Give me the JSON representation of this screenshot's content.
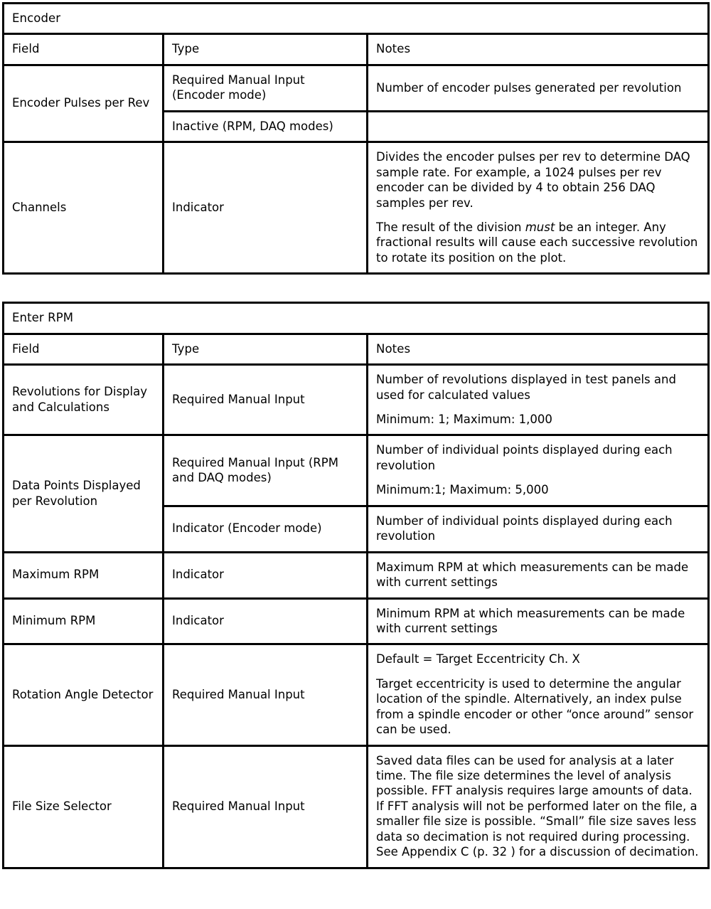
{
  "tables": [
    {
      "id": "encoder",
      "title": "Encoder",
      "headers": {
        "field": "Field",
        "type": "Type",
        "notes": "Notes"
      },
      "rows": [
        {
          "field": "Encoder Pulses per Rev",
          "subrows": [
            {
              "type": "Required Manual Input (Encoder mode)",
              "notes": [
                "Number of encoder pulses generated per revolution"
              ]
            },
            {
              "type": "Inactive (RPM, DAQ modes)",
              "notes": [
                ""
              ]
            }
          ]
        },
        {
          "field": "Channels",
          "subrows": [
            {
              "type": "Indicator",
              "notes": [
                "Divides the encoder pulses per rev to determine DAQ sample rate. For example, a 1024 pulses per rev encoder can be divided by 4 to obtain 256 DAQ samples per rev.",
                "The result of the division must be an integer. Any fractional results will cause each successive revolution to rotate its position on the plot."
              ],
              "notes_italic_word": "must"
            }
          ]
        }
      ]
    },
    {
      "id": "enter-rpm",
      "title": "Enter RPM",
      "headers": {
        "field": "Field",
        "type": "Type",
        "notes": "Notes"
      },
      "rows": [
        {
          "field": "Revolutions for Display and Calculations",
          "subrows": [
            {
              "type": "Required Manual Input",
              "notes": [
                "Number of revolutions displayed in test panels and used for calculated values",
                "Minimum: 1; Maximum: 1,000"
              ]
            }
          ]
        },
        {
          "field": "Data Points Displayed per Revolution",
          "subrows": [
            {
              "type": "Required Manual Input (RPM and DAQ modes)",
              "notes": [
                "Number of individual points displayed during each revolution",
                "Minimum:1; Maximum: 5,000"
              ]
            },
            {
              "type": "Indicator (Encoder mode)",
              "notes": [
                "Number of individual points displayed during each revolution"
              ]
            }
          ]
        },
        {
          "field": "Maximum RPM",
          "subrows": [
            {
              "type": "Indicator",
              "notes": [
                "Maximum RPM at which measurements can be made with current settings"
              ]
            }
          ]
        },
        {
          "field": "Minimum RPM",
          "subrows": [
            {
              "type": "Indicator",
              "notes": [
                "Minimum RPM at which measurements can be made with current settings"
              ]
            }
          ]
        },
        {
          "field": "Rotation Angle Detector",
          "subrows": [
            {
              "type": "Required Manual Input",
              "notes": [
                "Default = Target Eccentricity Ch. X",
                "Target eccentricity is used to determine the angular location of the spindle. Alternatively, an index pulse from a spindle encoder or other “once around” sensor can be used."
              ]
            }
          ]
        },
        {
          "field": "File Size Selector",
          "subrows": [
            {
              "type": "Required Manual Input",
              "notes": [
                "Saved data files can be used for analysis at a later time. The file size determines the level of analysis possible. FFT analysis requires large amounts of data. If FFT analysis will not be performed later on the file, a smaller file size is possible. “Small” file size saves less data so decimation is not required during processing. See Appendix C (p. 32 ) for a discussion of decimation."
              ]
            }
          ]
        }
      ]
    }
  ],
  "colors": {
    "border": "#000000",
    "text": "#000000",
    "background": "#ffffff"
  }
}
